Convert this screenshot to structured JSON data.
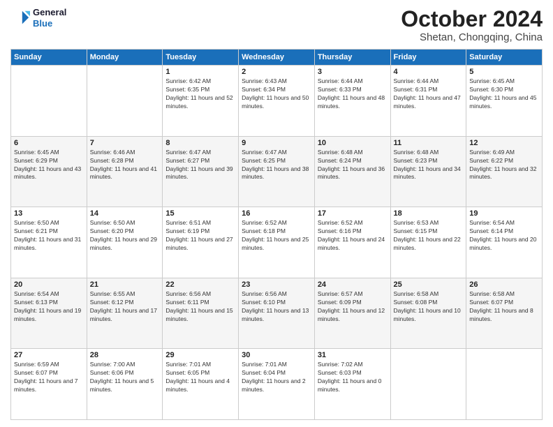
{
  "header": {
    "logo_line1": "General",
    "logo_line2": "Blue",
    "month": "October 2024",
    "location": "Shetan, Chongqing, China"
  },
  "weekdays": [
    "Sunday",
    "Monday",
    "Tuesday",
    "Wednesday",
    "Thursday",
    "Friday",
    "Saturday"
  ],
  "weeks": [
    [
      {
        "day": "",
        "info": ""
      },
      {
        "day": "",
        "info": ""
      },
      {
        "day": "1",
        "info": "Sunrise: 6:42 AM\nSunset: 6:35 PM\nDaylight: 11 hours and 52 minutes."
      },
      {
        "day": "2",
        "info": "Sunrise: 6:43 AM\nSunset: 6:34 PM\nDaylight: 11 hours and 50 minutes."
      },
      {
        "day": "3",
        "info": "Sunrise: 6:44 AM\nSunset: 6:33 PM\nDaylight: 11 hours and 48 minutes."
      },
      {
        "day": "4",
        "info": "Sunrise: 6:44 AM\nSunset: 6:31 PM\nDaylight: 11 hours and 47 minutes."
      },
      {
        "day": "5",
        "info": "Sunrise: 6:45 AM\nSunset: 6:30 PM\nDaylight: 11 hours and 45 minutes."
      }
    ],
    [
      {
        "day": "6",
        "info": "Sunrise: 6:45 AM\nSunset: 6:29 PM\nDaylight: 11 hours and 43 minutes."
      },
      {
        "day": "7",
        "info": "Sunrise: 6:46 AM\nSunset: 6:28 PM\nDaylight: 11 hours and 41 minutes."
      },
      {
        "day": "8",
        "info": "Sunrise: 6:47 AM\nSunset: 6:27 PM\nDaylight: 11 hours and 39 minutes."
      },
      {
        "day": "9",
        "info": "Sunrise: 6:47 AM\nSunset: 6:25 PM\nDaylight: 11 hours and 38 minutes."
      },
      {
        "day": "10",
        "info": "Sunrise: 6:48 AM\nSunset: 6:24 PM\nDaylight: 11 hours and 36 minutes."
      },
      {
        "day": "11",
        "info": "Sunrise: 6:48 AM\nSunset: 6:23 PM\nDaylight: 11 hours and 34 minutes."
      },
      {
        "day": "12",
        "info": "Sunrise: 6:49 AM\nSunset: 6:22 PM\nDaylight: 11 hours and 32 minutes."
      }
    ],
    [
      {
        "day": "13",
        "info": "Sunrise: 6:50 AM\nSunset: 6:21 PM\nDaylight: 11 hours and 31 minutes."
      },
      {
        "day": "14",
        "info": "Sunrise: 6:50 AM\nSunset: 6:20 PM\nDaylight: 11 hours and 29 minutes."
      },
      {
        "day": "15",
        "info": "Sunrise: 6:51 AM\nSunset: 6:19 PM\nDaylight: 11 hours and 27 minutes."
      },
      {
        "day": "16",
        "info": "Sunrise: 6:52 AM\nSunset: 6:18 PM\nDaylight: 11 hours and 25 minutes."
      },
      {
        "day": "17",
        "info": "Sunrise: 6:52 AM\nSunset: 6:16 PM\nDaylight: 11 hours and 24 minutes."
      },
      {
        "day": "18",
        "info": "Sunrise: 6:53 AM\nSunset: 6:15 PM\nDaylight: 11 hours and 22 minutes."
      },
      {
        "day": "19",
        "info": "Sunrise: 6:54 AM\nSunset: 6:14 PM\nDaylight: 11 hours and 20 minutes."
      }
    ],
    [
      {
        "day": "20",
        "info": "Sunrise: 6:54 AM\nSunset: 6:13 PM\nDaylight: 11 hours and 19 minutes."
      },
      {
        "day": "21",
        "info": "Sunrise: 6:55 AM\nSunset: 6:12 PM\nDaylight: 11 hours and 17 minutes."
      },
      {
        "day": "22",
        "info": "Sunrise: 6:56 AM\nSunset: 6:11 PM\nDaylight: 11 hours and 15 minutes."
      },
      {
        "day": "23",
        "info": "Sunrise: 6:56 AM\nSunset: 6:10 PM\nDaylight: 11 hours and 13 minutes."
      },
      {
        "day": "24",
        "info": "Sunrise: 6:57 AM\nSunset: 6:09 PM\nDaylight: 11 hours and 12 minutes."
      },
      {
        "day": "25",
        "info": "Sunrise: 6:58 AM\nSunset: 6:08 PM\nDaylight: 11 hours and 10 minutes."
      },
      {
        "day": "26",
        "info": "Sunrise: 6:58 AM\nSunset: 6:07 PM\nDaylight: 11 hours and 8 minutes."
      }
    ],
    [
      {
        "day": "27",
        "info": "Sunrise: 6:59 AM\nSunset: 6:07 PM\nDaylight: 11 hours and 7 minutes."
      },
      {
        "day": "28",
        "info": "Sunrise: 7:00 AM\nSunset: 6:06 PM\nDaylight: 11 hours and 5 minutes."
      },
      {
        "day": "29",
        "info": "Sunrise: 7:01 AM\nSunset: 6:05 PM\nDaylight: 11 hours and 4 minutes."
      },
      {
        "day": "30",
        "info": "Sunrise: 7:01 AM\nSunset: 6:04 PM\nDaylight: 11 hours and 2 minutes."
      },
      {
        "day": "31",
        "info": "Sunrise: 7:02 AM\nSunset: 6:03 PM\nDaylight: 11 hours and 0 minutes."
      },
      {
        "day": "",
        "info": ""
      },
      {
        "day": "",
        "info": ""
      }
    ]
  ]
}
